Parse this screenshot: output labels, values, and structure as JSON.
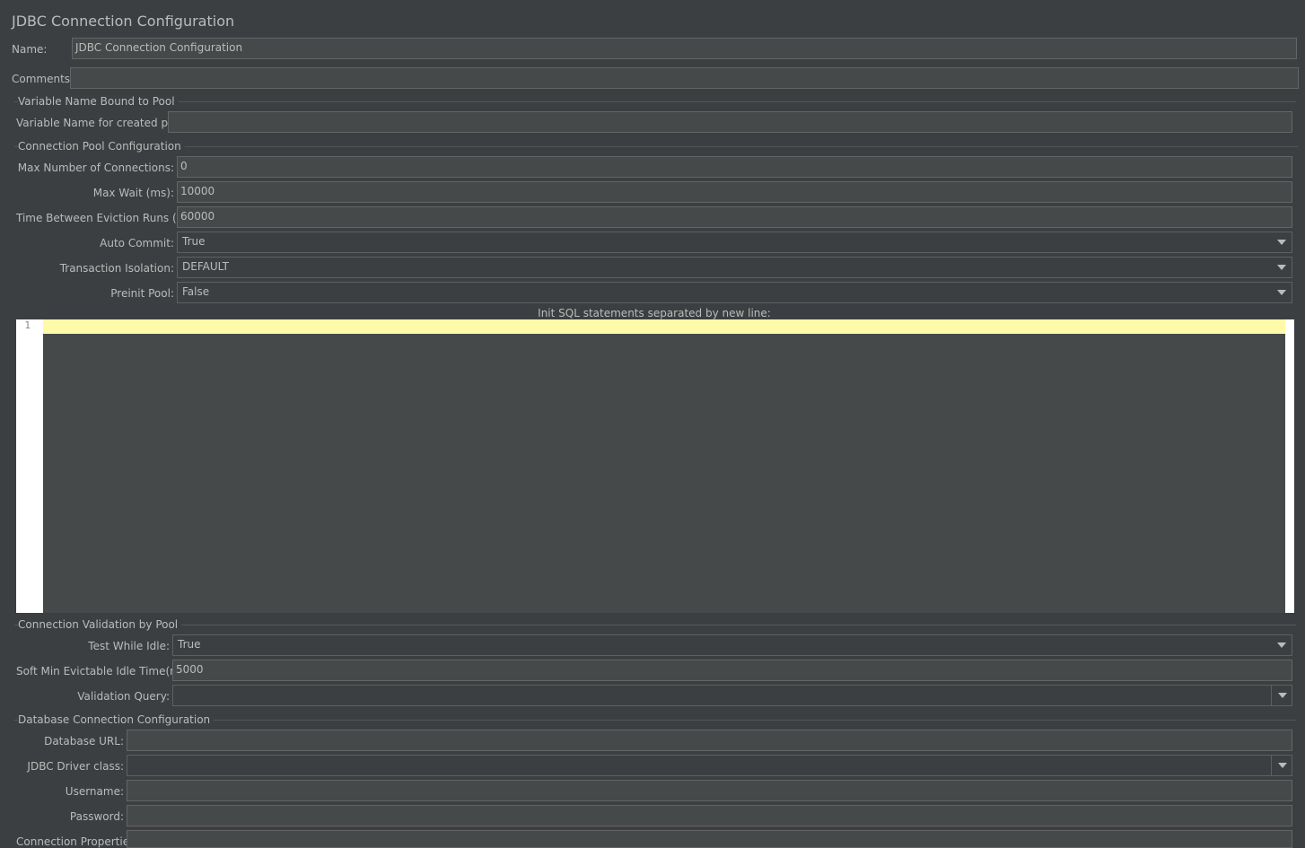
{
  "window": {
    "title": "JDBC Connection Configuration"
  },
  "general": {
    "name_label": "Name:",
    "name_value": "JDBC Connection Configuration",
    "comments_label": "Comments:",
    "comments_value": ""
  },
  "variable_section": {
    "title": "Variable Name Bound to Pool",
    "var_label": "Variable Name for created pool:",
    "var_value": ""
  },
  "pool_section": {
    "title": "Connection Pool Configuration",
    "max_connections_label": "Max Number of Connections:",
    "max_connections_value": "0",
    "max_wait_label": "Max Wait (ms):",
    "max_wait_value": "10000",
    "eviction_label": "Time Between Eviction Runs (ms):",
    "eviction_value": "60000",
    "auto_commit_label": "Auto Commit:",
    "auto_commit_value": "True",
    "isolation_label": "Transaction Isolation:",
    "isolation_value": "DEFAULT",
    "preinit_label": "Preinit Pool:",
    "preinit_value": "False",
    "init_sql_label": "Init SQL statements separated by new line:",
    "init_sql_line_number": "1",
    "init_sql_value": ""
  },
  "validation_section": {
    "title": "Connection Validation by Pool",
    "test_idle_label": "Test While Idle:",
    "test_idle_value": "True",
    "soft_min_label": "Soft Min Evictable Idle Time(ms):",
    "soft_min_value": "5000",
    "validation_query_label": "Validation Query:",
    "validation_query_value": ""
  },
  "database_section": {
    "title": "Database Connection Configuration",
    "url_label": "Database URL:",
    "url_value": "",
    "driver_label": "JDBC Driver class:",
    "driver_value": "",
    "username_label": "Username:",
    "username_value": "",
    "password_label": "Password:",
    "password_value": "",
    "properties_label": "Connection Properties:",
    "properties_value": ""
  },
  "colors": {
    "background": "#3c3f41",
    "field_background": "#45494a",
    "current_line_highlight": "#fffaa8",
    "text": "#bbbbbb"
  },
  "icons": {
    "dropdown": "chevron-down-icon"
  }
}
